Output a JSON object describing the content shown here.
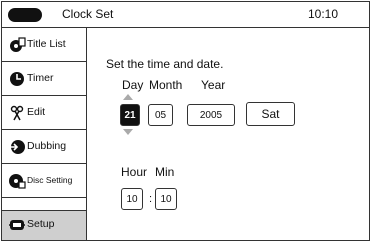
{
  "header": {
    "title": "Clock Set",
    "time": "10:10"
  },
  "sidebar": {
    "items": [
      {
        "label": "Title List",
        "icon": "title-list-icon"
      },
      {
        "label": "Timer",
        "icon": "timer-icon"
      },
      {
        "label": "Edit",
        "icon": "edit-icon"
      },
      {
        "label": "Dubbing",
        "icon": "dubbing-icon"
      },
      {
        "label": "Disc Setting",
        "icon": "disc-setting-icon"
      },
      {
        "label": "Setup",
        "icon": "setup-icon",
        "active": true
      }
    ]
  },
  "main": {
    "instruction": "Set the time and date.",
    "date_headers": {
      "day": "Day",
      "month": "Month",
      "year": "Year"
    },
    "date_values": {
      "day": "21",
      "month": "05",
      "year": "2005",
      "weekday": "Sat"
    },
    "time_headers": {
      "hour": "Hour",
      "min": "Min"
    },
    "time_values": {
      "hour": "10",
      "min": "10"
    },
    "time_separator": ":"
  }
}
